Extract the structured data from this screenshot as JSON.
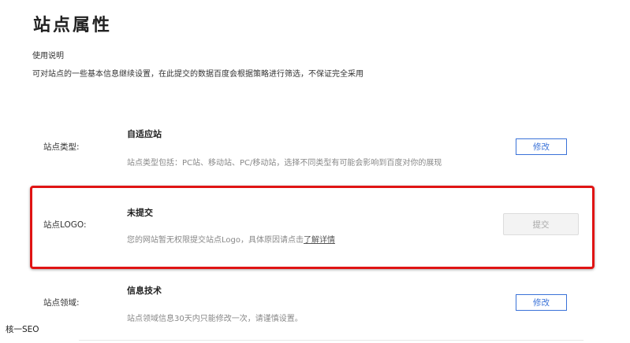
{
  "page": {
    "title": "站点属性",
    "usage_label": "使用说明",
    "usage_desc": "可对站点的一些基本信息继续设置，在此提交的数据百度会根据策略进行筛选，不保证完全采用"
  },
  "site_type": {
    "label": "站点类型:",
    "value": "自适应站",
    "note": "站点类型包括：PC站、移动站、PC/移动站，选择不同类型有可能会影响到百度对你的展现",
    "button": "修改"
  },
  "site_logo": {
    "label": "站点LOGO:",
    "value": "未提交",
    "note_prefix": "您的网站暂无权限提交站点Logo，具体原因请点击",
    "note_link": "了解详情",
    "button": "提交"
  },
  "site_domain": {
    "label": "站点领域:",
    "value": "信息技术",
    "note": "站点领域信息30天内只能修改一次，请谨慎设置。",
    "button": "修改"
  },
  "watermark": "核一SEO",
  "colors": {
    "accent": "#3a72d8",
    "highlight": "#e01414"
  }
}
